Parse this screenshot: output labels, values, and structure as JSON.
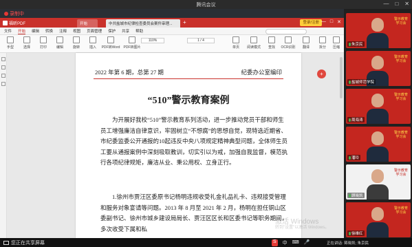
{
  "meeting": {
    "title": "腾讯会议",
    "window_controls": [
      "—",
      "□",
      "✕"
    ]
  },
  "recording": {
    "label": "录制中"
  },
  "foxit": {
    "app_name": "福昕PDF",
    "tabs": [
      {
        "label": "开始"
      },
      {
        "label": "中共盐城市纪律检查委员会案件审理..."
      }
    ],
    "new_tab": "+",
    "login_label": "登录/注册",
    "menu": [
      "文件",
      "开始",
      "编辑",
      "转换",
      "注释",
      "视图",
      "页面管理",
      "保护",
      "共享",
      "帮助"
    ],
    "menu_active_index": 1,
    "tools": [
      "手型",
      "选择",
      "打印",
      "编辑",
      "旋转",
      "插入",
      "PDF转Word",
      "PDF转图片",
      "页面编辑",
      "",
      "",
      "",
      "放大",
      "缩小",
      "单页",
      "阅读模式",
      "查找",
      "OCR识别",
      "翻译",
      "拆分",
      "压缩",
      "更多"
    ],
    "zoom": "110%",
    "page_indicator": "1 / 4"
  },
  "document": {
    "issue": "2022 年第 6 期，总第 27 期",
    "office": "纪委办公室编印",
    "title": "“510”警示教育案例",
    "paragraph1": "为开展好我校“510”警示教育系列活动，进一步推动党员干部和师生员工增强廉洁自律意识，牢固树立“不想腐”的思想自觉，现特选近期省、市纪委监委公开通报的10起违反中央八项规定精神典型问题，全体师生员工要从通报案例中深刻吸取教训，切实引以为戒，加强自我监督，模范执行各项纪律规矩，廉洁从业、秉公用权、立身正行。",
    "paragraph2": "1.徐州市贾汪区委原书记杨明违规收受礼金礼品礼卡、违规接受管理和服务对象宴请等问题。2013 年 8 月至 2021 年 2 月，杨明在担任铜山区委副书记、徐州市城乡建设局局长、贾汪区区长和区委书记等职务期间，多次收受下属和私"
  },
  "watermark": {
    "line1": "激活 Windows",
    "line2": "转到\"设置\"以激活 Windows。"
  },
  "taskbar": {
    "sharing_label": "您正在共享屏幕",
    "speaking": "正在讲话: 蒋晓凯; 朱京民"
  },
  "participants": [
    {
      "name": "朱京民",
      "bg": "警示教育学习会",
      "theme": "red"
    },
    {
      "name": "盐城师范学院",
      "bg": "警示教育学习会",
      "theme": "red"
    },
    {
      "name": "周海涛",
      "bg": "警示教育学习会",
      "theme": "red"
    },
    {
      "name": "潘玲",
      "bg": "警示教育学习会",
      "theme": "red"
    },
    {
      "name": "顾晓凯",
      "bg": "警示教育学习会",
      "theme": "white"
    },
    {
      "name": "徐维红",
      "bg": "警示教育学习会",
      "theme": "red"
    }
  ]
}
